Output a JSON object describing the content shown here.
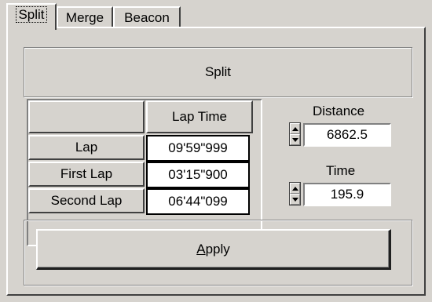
{
  "tabs": [
    {
      "label": "Split",
      "active": true
    },
    {
      "label": "Merge",
      "active": false
    },
    {
      "label": "Beacon",
      "active": false
    }
  ],
  "split_button": {
    "label": "Split"
  },
  "table": {
    "corner_label": "",
    "column_header": "Lap Time",
    "rows": [
      {
        "label": "Lap",
        "value": "09'59\"999"
      },
      {
        "label": "First Lap",
        "value": "03'15\"900"
      },
      {
        "label": "Second Lap",
        "value": "06'44\"099"
      }
    ]
  },
  "distance": {
    "label": "Distance",
    "value": "6862.5"
  },
  "time": {
    "label": "Time",
    "value": "195.9"
  },
  "apply_button": {
    "label_prefix": "",
    "label_underlined": "A",
    "label_rest": "pply"
  }
}
